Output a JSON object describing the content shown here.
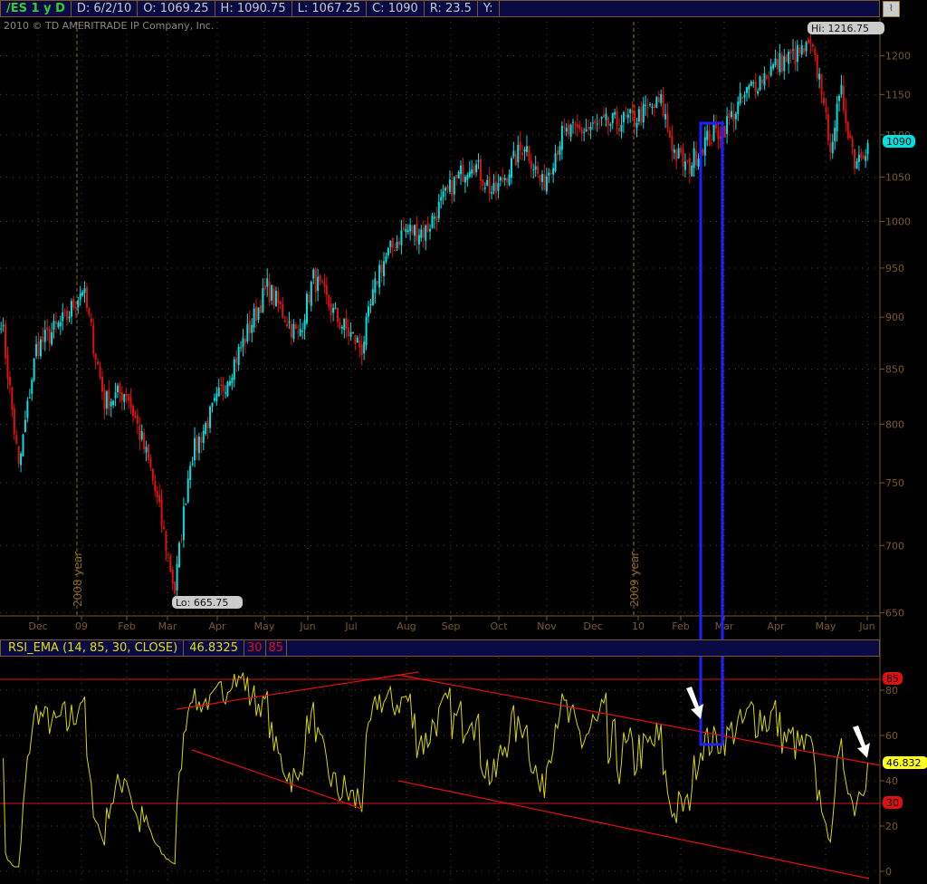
{
  "header": {
    "symbol": "/ES 1 y D",
    "date": "D: 6/2/10",
    "open": "O: 1069.25",
    "high": "H: 1090.75",
    "low": "L: 1067.25",
    "close": "C: 1090",
    "range": "R: 23.5",
    "y": "Y:",
    "copyright": "2010 © TD AMERITRADE IP Company, Inc."
  },
  "rsi_header": {
    "name": "RSI_EMA (14, 85, 30, CLOSE)",
    "value": "46.8325",
    "low": "30",
    "high": "85"
  },
  "chart_data": [
    {
      "type": "candlestick",
      "title": "/ES 1 y D",
      "scale": "log",
      "y_ticks": [
        650,
        700,
        750,
        800,
        850,
        900,
        950,
        1000,
        1050,
        1100,
        1150,
        1200
      ],
      "x_ticks": [
        "Dec",
        "09",
        "Feb",
        "Mar",
        "Apr",
        "May",
        "Jun",
        "Jul",
        "Aug",
        "Sep",
        "Oct",
        "Nov",
        "Dec",
        "10",
        "Feb",
        "Mar",
        "Apr",
        "May",
        "Jun"
      ],
      "year_markers": [
        "2008 year",
        "2009 year"
      ],
      "hi_label": "Hi: 1216.75",
      "lo_label": "Lo: 665.75",
      "last_label": "1090",
      "close_anchors": [
        [
          0,
          900
        ],
        [
          8,
          760
        ],
        [
          16,
          870
        ],
        [
          30,
          900
        ],
        [
          37,
          930
        ],
        [
          47,
          820
        ],
        [
          57,
          830
        ],
        [
          68,
          760
        ],
        [
          79,
          666
        ],
        [
          86,
          770
        ],
        [
          98,
          820
        ],
        [
          111,
          880
        ],
        [
          121,
          930
        ],
        [
          135,
          880
        ],
        [
          142,
          940
        ],
        [
          152,
          900
        ],
        [
          164,
          870
        ],
        [
          172,
          950
        ],
        [
          183,
          990
        ],
        [
          193,
          990
        ],
        [
          205,
          1040
        ],
        [
          214,
          1070
        ],
        [
          224,
          1030
        ],
        [
          238,
          1090
        ],
        [
          246,
          1040
        ],
        [
          255,
          1100
        ],
        [
          271,
          1110
        ],
        [
          288,
          1120
        ],
        [
          300,
          1140
        ],
        [
          306,
          1080
        ],
        [
          312,
          1060
        ],
        [
          319,
          1090
        ],
        [
          329,
          1110
        ],
        [
          341,
          1160
        ],
        [
          353,
          1190
        ],
        [
          368,
          1210
        ],
        [
          374,
          1150
        ],
        [
          376,
          1080
        ],
        [
          382,
          1150
        ],
        [
          388,
          1070
        ],
        [
          394,
          1090
        ]
      ],
      "up_color": "#00e0e0",
      "down_color": "#e01010"
    },
    {
      "type": "line",
      "title": "RSI_EMA (14, 85, 30, CLOSE)",
      "y_ticks": [
        0,
        20,
        40,
        60,
        80
      ],
      "levels": [
        30,
        85
      ],
      "last_value_label": "46.832",
      "ylim": [
        0,
        90
      ],
      "color": "#d8d800"
    }
  ]
}
